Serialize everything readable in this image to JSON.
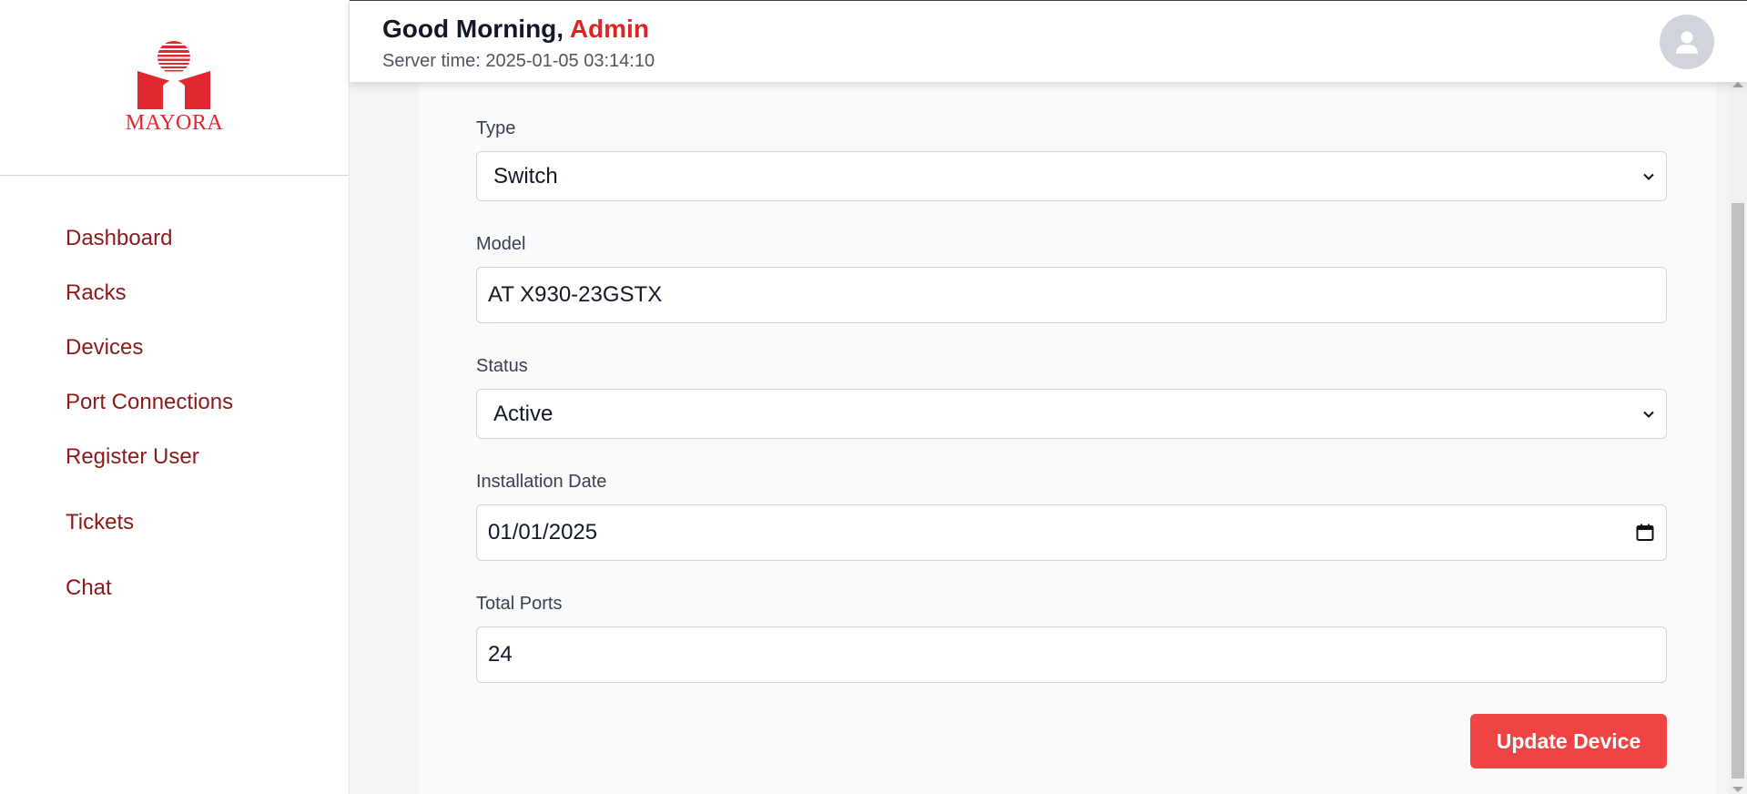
{
  "brand": {
    "name": "MAYORA",
    "color": "#e0282e"
  },
  "sidebar": {
    "items": [
      {
        "label": "Dashboard"
      },
      {
        "label": "Racks"
      },
      {
        "label": "Devices"
      },
      {
        "label": "Port Connections"
      },
      {
        "label": "Register User"
      },
      {
        "label": "Tickets"
      },
      {
        "label": "Chat"
      }
    ]
  },
  "header": {
    "greeting": "Good Morning,",
    "user": "Admin",
    "server_time": "Server time: 2025-01-05 03:14:10",
    "avatar_icon": "user-icon"
  },
  "form": {
    "type": {
      "label": "Type",
      "value": "Switch"
    },
    "model": {
      "label": "Model",
      "value": "AT X930-23GSTX"
    },
    "status": {
      "label": "Status",
      "value": "Active"
    },
    "installation_date": {
      "label": "Installation Date",
      "value": "01/01/2025"
    },
    "total_ports": {
      "label": "Total Ports",
      "value": "24"
    },
    "submit_label": "Update Device"
  },
  "colors": {
    "accent": "#ef4444",
    "nav_text": "#8b1a1a",
    "greeting_name": "#dc2626"
  }
}
